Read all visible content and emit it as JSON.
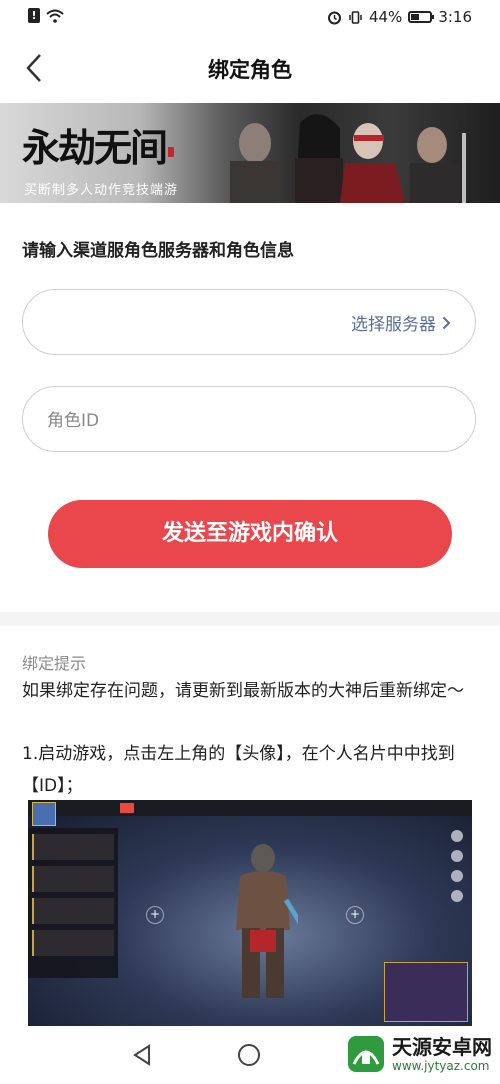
{
  "status_bar": {
    "battery": "44%",
    "battery_level": 0.44,
    "time": "3:16",
    "alert_glyph": "!"
  },
  "header": {
    "title": "绑定角色"
  },
  "banner": {
    "logo_text": "永劫无间",
    "slogan": "买断制多人动作竞技端游"
  },
  "form": {
    "section_label": "请输入渠道服角色服务器和角色信息",
    "server_select_label": "选择服务器",
    "role_id_placeholder": "角色ID",
    "role_id_value": "",
    "submit_label": "发送至游戏内确认"
  },
  "tips": {
    "title": "绑定提示",
    "body": "如果绑定存在问题，请更新到最新版本的大神后重新绑定～",
    "step_1": "1.启动游戏，点击左上角的【头像】，在个人名片中中找到【ID】；"
  },
  "watermark": {
    "name": "天源安卓网",
    "url": "www.jytyaz.com"
  },
  "colors": {
    "accent": "#e9474b",
    "link": "#5a6f9a",
    "muted": "#8a8a8a"
  },
  "icons": {
    "back": "chevron-left-icon",
    "server_arrow": "chevron-right-icon",
    "nav_back": "triangle-back-icon",
    "nav_home": "circle-home-icon"
  }
}
